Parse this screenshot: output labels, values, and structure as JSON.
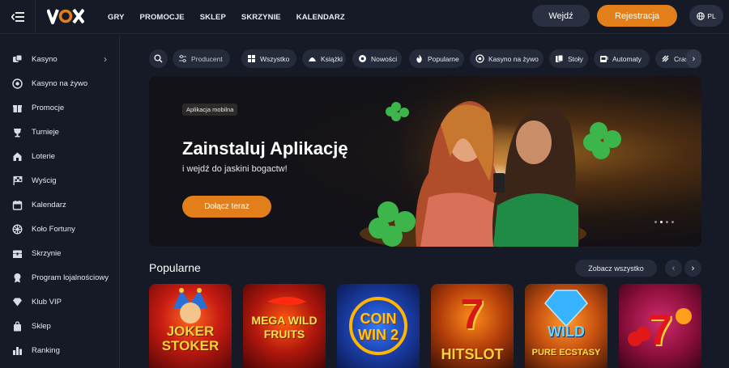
{
  "header": {
    "logo_text": "VOX",
    "nav": [
      "GRY",
      "PROMOCJE",
      "SKLEP",
      "SKRZYNIE",
      "KALENDARZ"
    ],
    "login_label": "Wejdź",
    "register_label": "Rejestracja",
    "language": "PL",
    "accent_color": "#e37f1a"
  },
  "sidebar": {
    "items": [
      {
        "label": "Kasyno",
        "icon": "dice-icon",
        "has_arrow": true
      },
      {
        "label": "Kasyno na żywo",
        "icon": "live-chip-icon"
      },
      {
        "label": "Promocje",
        "icon": "gift-icon"
      },
      {
        "label": "Turnieje",
        "icon": "trophy-icon"
      },
      {
        "label": "Loterie",
        "icon": "lottery-icon"
      },
      {
        "label": "Wyścig",
        "icon": "race-flag-icon"
      },
      {
        "label": "Kalendarz",
        "icon": "calendar-icon"
      },
      {
        "label": "Koło Fortuny",
        "icon": "wheel-icon"
      },
      {
        "label": "Skrzynie",
        "icon": "chest-icon"
      },
      {
        "label": "Program lojalnościowy",
        "icon": "loyalty-icon"
      },
      {
        "label": "Klub VIP",
        "icon": "diamond-icon"
      },
      {
        "label": "Sklep",
        "icon": "bag-icon"
      },
      {
        "label": "Ranking",
        "icon": "ranking-icon"
      }
    ]
  },
  "filters": {
    "producer_label": "Producent",
    "categories": [
      "Wszystko",
      "Książki",
      "Nowości",
      "Popularne",
      "Kasyno na żywo",
      "Stoły",
      "Automaty",
      "Cras"
    ]
  },
  "banner": {
    "tag": "Aplikacja mobilna",
    "title": "Zainstaluj Aplikację",
    "subtitle": "i wejdź do jaskini bogactw!",
    "cta": "Dołącz teraz",
    "slide_count": 4,
    "active_slide": 2
  },
  "popular": {
    "title": "Popularne",
    "see_all": "Zobacz wszystko",
    "games": [
      {
        "line1": "JOKER",
        "line2": "STOKER"
      },
      {
        "line1": "MEGA WILD",
        "line2": "FRUITS"
      },
      {
        "line1": "COIN",
        "line2": "WIN 2"
      },
      {
        "line1": "7",
        "line2": "HITSLOT"
      },
      {
        "line1": "WILD",
        "line2": "PURE ECSTASY"
      },
      {
        "line1": "7",
        "line2": ""
      }
    ]
  }
}
